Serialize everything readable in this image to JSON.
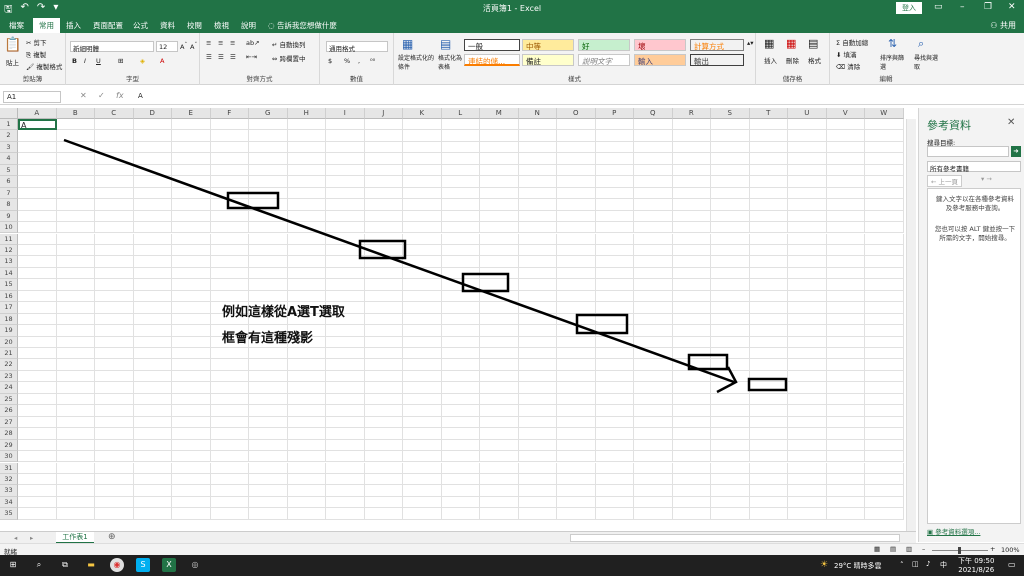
{
  "window": {
    "title": "活頁簿1  -  Excel",
    "login_label": "登入",
    "min_icon": "minimize-icon",
    "max_icon": "restore-icon",
    "close_icon": "close-icon"
  },
  "ribbon_tabs": [
    "檔案",
    "常用",
    "插入",
    "頁面配置",
    "公式",
    "資料",
    "校閱",
    "檢視",
    "說明"
  ],
  "active_tab": "常用",
  "tell_me": "告訴我您想做什麼",
  "share_label": "共用",
  "ribbon": {
    "clipboard": {
      "paste": "貼上",
      "cut": "剪下",
      "copy": "複製",
      "format_painter": "複製格式",
      "label": "剪貼簿"
    },
    "font": {
      "name": "新細明體",
      "size": "12",
      "label": "字型",
      "bold": "B",
      "italic": "I",
      "underline": "U"
    },
    "alignment": {
      "wrap": "自動換列",
      "merge": "跨欄置中",
      "label": "對齊方式"
    },
    "number": {
      "format": "通用格式",
      "currency": "$",
      "percent": "%",
      "comma": ",",
      "label": "數值"
    },
    "styles": {
      "cond": "設定格式化的條件",
      "table": "格式化為表格",
      "cells": [
        "一般",
        "中等",
        "好",
        "壞",
        "計算方式",
        "連結的儲...",
        "備註",
        "說明文字",
        "輸入",
        "輸出"
      ],
      "label": "樣式"
    },
    "cells_group": {
      "insert": "插入",
      "delete": "刪除",
      "format": "格式",
      "label": "儲存格"
    },
    "editing": {
      "autosum": "自動加總",
      "fill": "填滿",
      "clear": "清除",
      "sort": "排序與篩選",
      "find": "尋找與選取",
      "label": "編輯"
    }
  },
  "formula_bar": {
    "name_box": "A1",
    "content": "A",
    "cancel": "✕",
    "enter": "✓",
    "fx": "fx"
  },
  "columns": [
    "A",
    "B",
    "C",
    "D",
    "E",
    "F",
    "G",
    "H",
    "I",
    "J",
    "K",
    "L",
    "M",
    "N",
    "O",
    "P",
    "Q",
    "R",
    "S",
    "T",
    "U",
    "V",
    "W"
  ],
  "rows": [
    "1",
    "2",
    "3",
    "4",
    "5",
    "6",
    "7",
    "8",
    "9",
    "10",
    "11",
    "12",
    "13",
    "14",
    "15",
    "16",
    "17",
    "18",
    "19",
    "20",
    "21",
    "22",
    "23",
    "24",
    "25",
    "26",
    "27",
    "28",
    "29",
    "30",
    "31",
    "32",
    "33",
    "34",
    "35"
  ],
  "cell_a1": "A",
  "annotation": {
    "line1": "例如這樣從A選T選取",
    "line2": "框會有這種殘影"
  },
  "research_pane": {
    "title": "參考資料",
    "search_label": "搜尋目標:",
    "source": "所有參考書籍",
    "back": "上一頁",
    "help1": "鍵入文字以在各種參考資料及參考服務中查詢。",
    "help2": "您也可以按 ALT 鍵並按一下所需的文字，開始搜尋。",
    "options_link": "參考資料選項..."
  },
  "sheet_tab": "工作表1",
  "status": {
    "ready": "就緒",
    "zoom": "100%"
  },
  "taskbar": {
    "weather": "29°C  晴時多雲",
    "time": "下午 09:50",
    "date": "2021/8/26"
  }
}
